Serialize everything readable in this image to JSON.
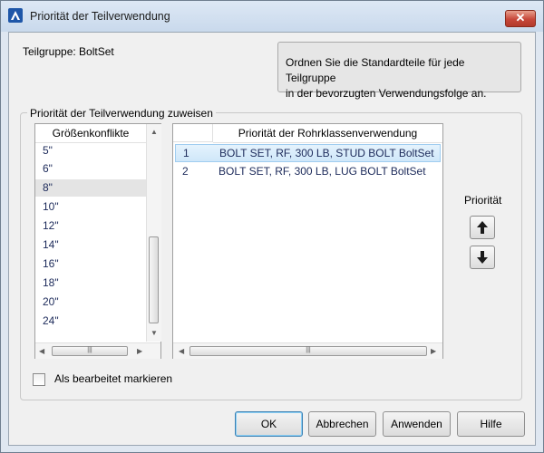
{
  "window": {
    "title": "Priorität der Teilverwendung",
    "close_label": "✕"
  },
  "group": {
    "label": "Teilgruppe: BoltSet"
  },
  "hint": {
    "line1": "Ordnen Sie die Standardteile für jede Teilgruppe",
    "line2": "in der bevorzugten Verwendungsfolge an."
  },
  "assign": {
    "legend": "Priorität der Teilverwendung zuweisen"
  },
  "size_list": {
    "header": "Größenkonflikte",
    "items": [
      "5\"",
      "6\"",
      "8\"",
      "10\"",
      "12\"",
      "14\"",
      "16\"",
      "18\"",
      "20\"",
      "24\""
    ],
    "selected": "8\""
  },
  "priority_list": {
    "header": "Priorität der Rohrklassenverwendung",
    "rows": [
      {
        "num": "1",
        "text": "BOLT SET, RF, 300 LB, STUD BOLT BoltSet"
      },
      {
        "num": "2",
        "text": "BOLT SET, RF, 300 LB, LUG BOLT BoltSet"
      }
    ]
  },
  "priority_controls": {
    "label": "Priorität"
  },
  "mark_edited": {
    "label": "Als bearbeitet markieren",
    "checked": false
  },
  "buttons": {
    "ok": "OK",
    "cancel": "Abbrechen",
    "apply": "Anwenden",
    "help": "Hilfe"
  },
  "colors": {
    "selection": "#cfe7f9",
    "close_button": "#c7473a"
  }
}
